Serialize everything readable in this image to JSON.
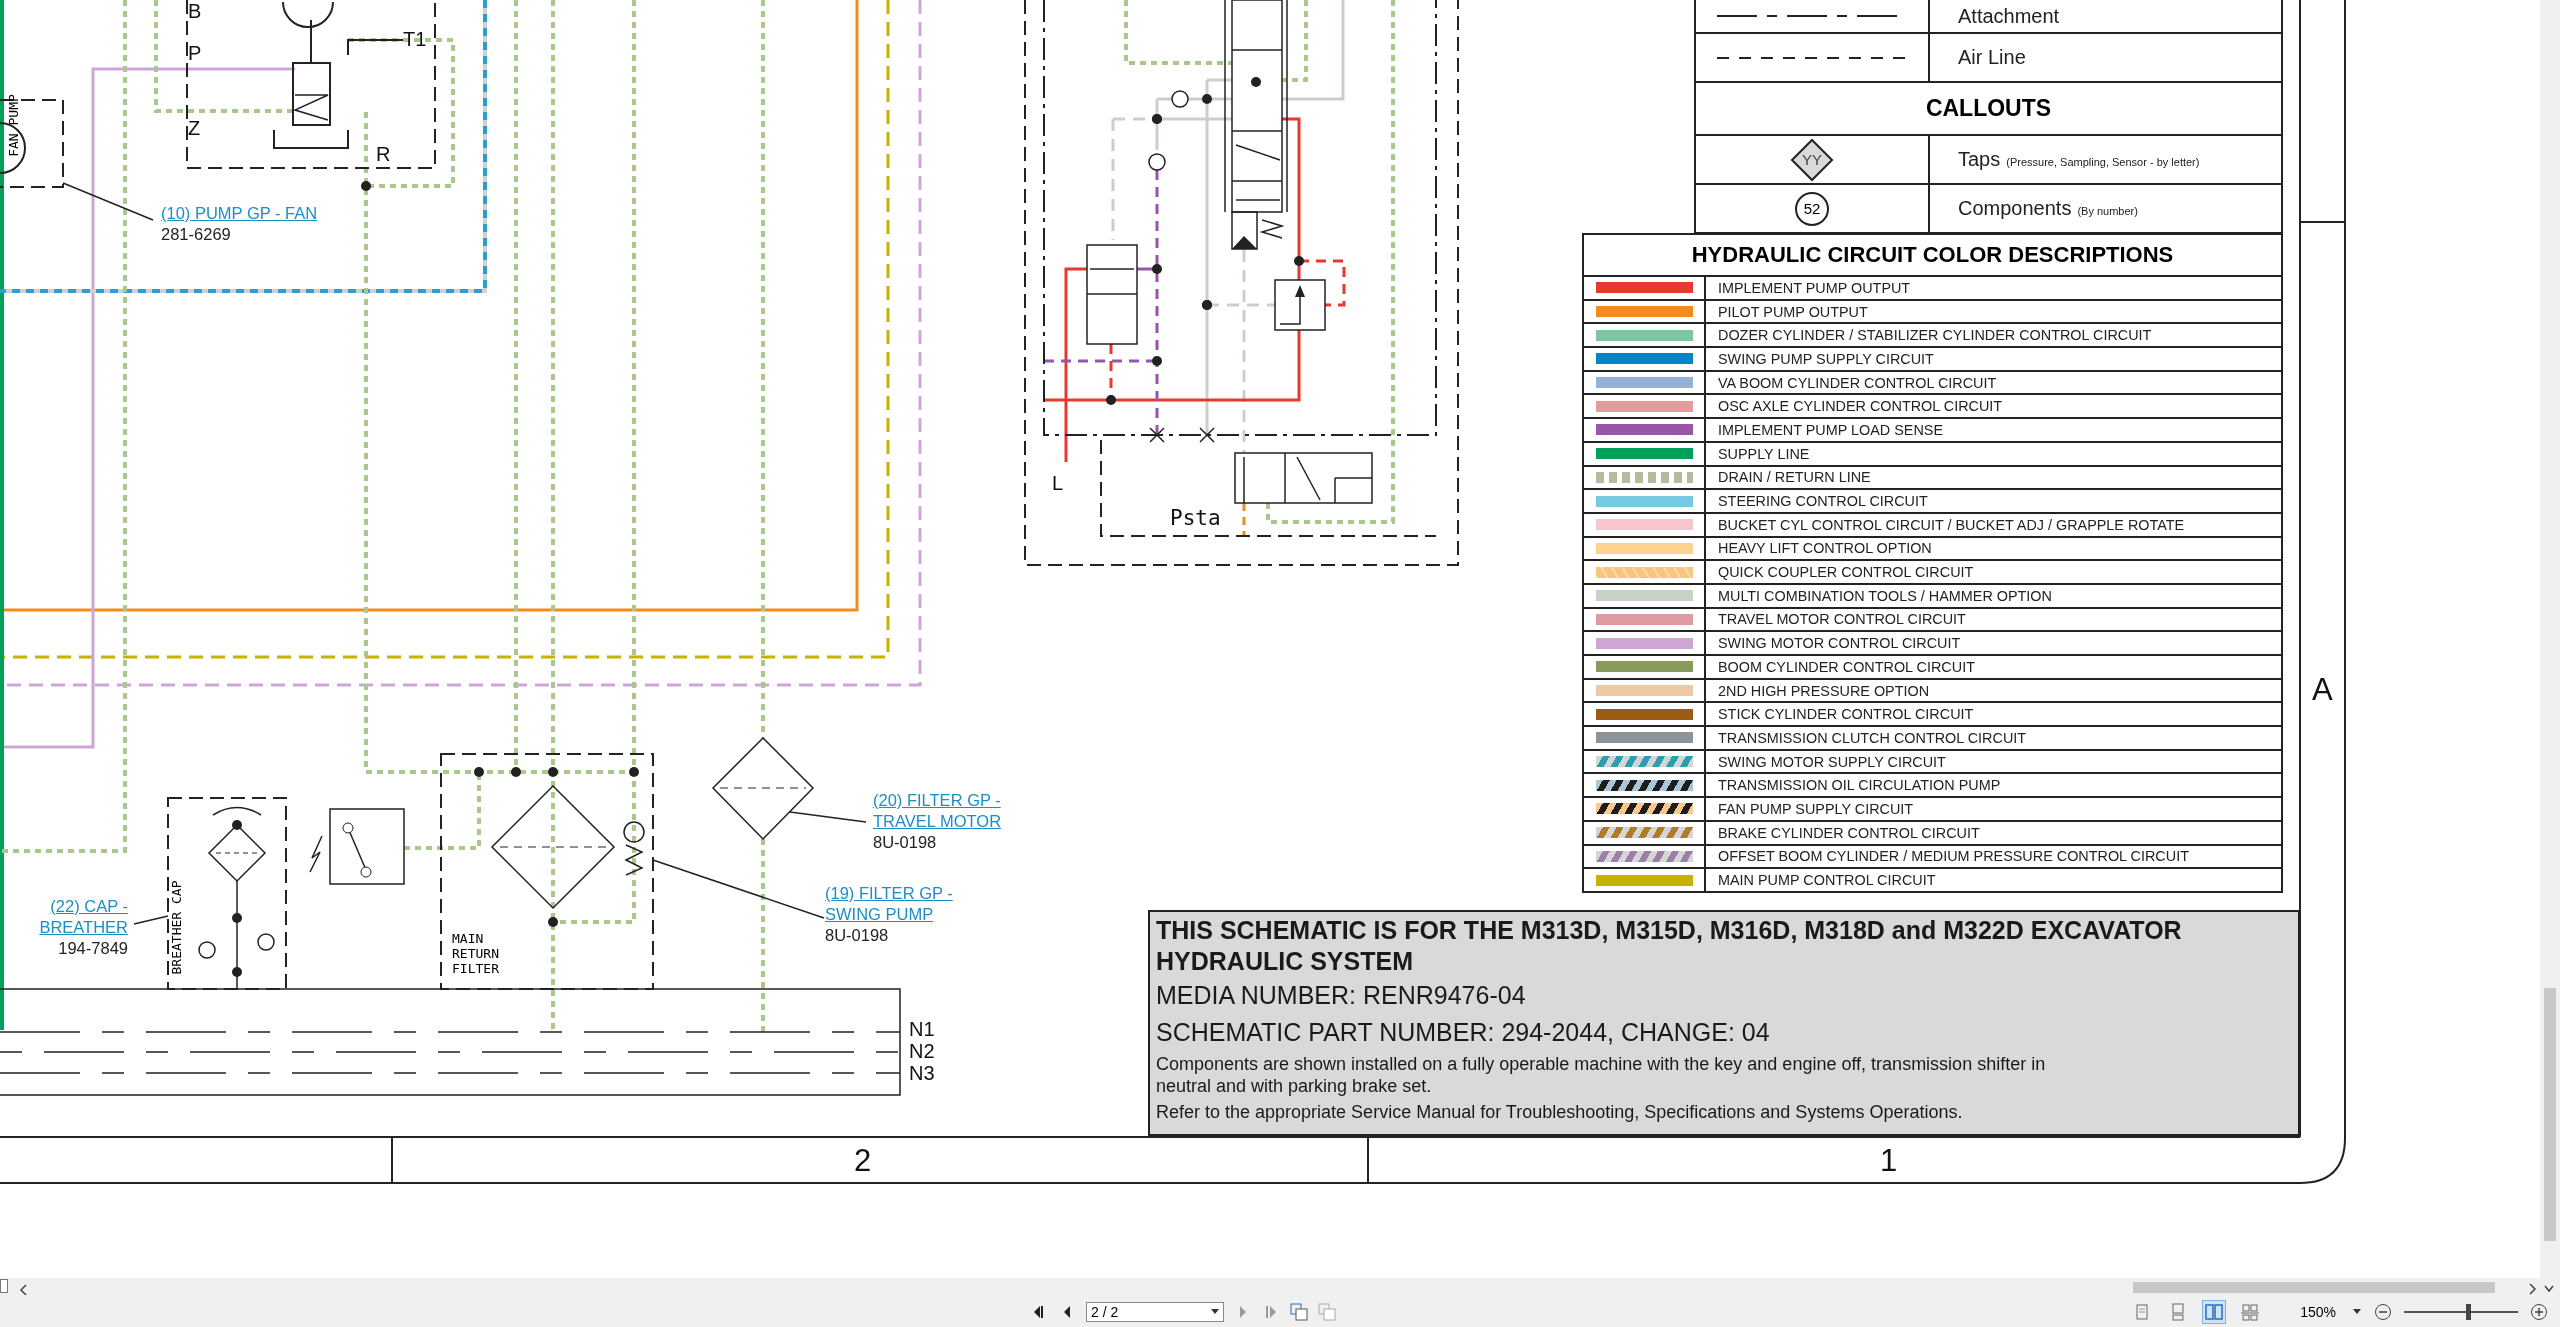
{
  "line_legend": [
    {
      "kind": "long-dash",
      "label": "Attachment"
    },
    {
      "kind": "short-dash",
      "label": "Air Line"
    }
  ],
  "callouts": {
    "title": "CALLOUTS",
    "items": [
      {
        "kind": "tap",
        "symbol": "YY",
        "label": "Taps",
        "note": "(Pressure, Sampling, Sensor - by letter)"
      },
      {
        "kind": "component",
        "symbol": "52",
        "label": "Components",
        "note": "(By number)"
      }
    ]
  },
  "color_legend": {
    "title": "HYDRAULIC CIRCUIT COLOR DESCRIPTIONS",
    "items": [
      {
        "kind": "solid",
        "color": "#e8392f",
        "label": "IMPLEMENT PUMP OUTPUT"
      },
      {
        "kind": "solid",
        "color": "#f28c1f",
        "label": "PILOT PUMP OUTPUT"
      },
      {
        "kind": "solid",
        "color": "#7cc7a0",
        "label": "DOZER CYLINDER / STABILIZER CYLINDER CONTROL CIRCUIT"
      },
      {
        "kind": "solid",
        "color": "#0a83c4",
        "label": "SWING PUMP SUPPLY CIRCUIT"
      },
      {
        "kind": "solid",
        "color": "#94b1d6",
        "label": "VA BOOM CYLINDER CONTROL CIRCUIT"
      },
      {
        "kind": "solid",
        "color": "#e29c9c",
        "label": "OSC AXLE CYLINDER CONTROL CIRCUIT"
      },
      {
        "kind": "solid",
        "color": "#9955a8",
        "label": "IMPLEMENT PUMP LOAD SENSE"
      },
      {
        "kind": "solid",
        "color": "#00a05a",
        "label": "SUPPLY LINE"
      },
      {
        "kind": "dotted",
        "color": "#bbb8a0",
        "label": "DRAIN / RETURN LINE"
      },
      {
        "kind": "solid",
        "color": "#76c8e4",
        "label": "STEERING CONTROL CIRCUIT"
      },
      {
        "kind": "solid",
        "color": "#f6c6d0",
        "label": "BUCKET CYL CONTROL CIRCUIT / BUCKET ADJ / GRAPPLE ROTATE"
      },
      {
        "kind": "solid",
        "color": "#fdd390",
        "label": "HEAVY LIFT CONTROL OPTION"
      },
      {
        "kind": "mottled",
        "color": "#f9c57e",
        "label": "QUICK COUPLER CONTROL CIRCUIT"
      },
      {
        "kind": "solid",
        "color": "#c9d0c8",
        "label": "MULTI COMBINATION TOOLS / HAMMER OPTION"
      },
      {
        "kind": "solid",
        "color": "#dd9aa0",
        "label": "TRAVEL MOTOR CONTROL CIRCUIT"
      },
      {
        "kind": "solid",
        "color": "#cda6d6",
        "label": "SWING MOTOR CONTROL CIRCUIT"
      },
      {
        "kind": "solid",
        "color": "#8a9a5b",
        "label": "BOOM CYLINDER CONTROL CIRCUIT"
      },
      {
        "kind": "solid",
        "color": "#eec7a4",
        "label": "2ND HIGH PRESSURE OPTION"
      },
      {
        "kind": "solid",
        "color": "#9a5b14",
        "label": "STICK CYLINDER CONTROL CIRCUIT"
      },
      {
        "kind": "solid",
        "color": "#8c9499",
        "label": "TRANSMISSION CLUTCH CONTROL CIRCUIT"
      },
      {
        "kind": "striped",
        "color": "#2a9fb0",
        "stripe": {
          "color": "#d2d6d6"
        },
        "label": "SWING MOTOR SUPPLY CIRCUIT"
      },
      {
        "kind": "striped",
        "color": "#1d1d1d",
        "stripe": {
          "color": "#a9c7d8"
        },
        "label": "TRANSMISSION OIL CIRCULATION PUMP"
      },
      {
        "kind": "striped",
        "color": "#1d1d1d",
        "stripe": {
          "color": "#f9c88a"
        },
        "label": "FAN PUMP SUPPLY CIRCUIT"
      },
      {
        "kind": "striped",
        "color": "#b07a2a",
        "stripe": {
          "color": "#d2d6d6"
        },
        "label": "BRAKE CYLINDER CONTROL CIRCUIT"
      },
      {
        "kind": "striped",
        "color": "#9a80a8",
        "stripe": {
          "color": "#d6d6d6"
        },
        "label": "OFFSET BOOM CYLINDER / MEDIUM PRESSURE CONTROL CIRCUIT"
      },
      {
        "kind": "solid",
        "color": "#c5b300",
        "label": "MAIN PUMP CONTROL CIRCUIT"
      }
    ]
  },
  "schematic": {
    "port_labels": [
      "B",
      "P",
      "T1",
      "Z",
      "R",
      "L",
      "Psta"
    ],
    "tank_levels": [
      "N1",
      "N2",
      "N3"
    ],
    "component_labels": [
      "FAN PUMP",
      "BREATHER CAP",
      "MAIN RETURN FILTER"
    ],
    "callouts": [
      {
        "title_lines": [
          "(10) PUMP GP - FAN"
        ],
        "part": "281-6269"
      },
      {
        "title_lines": [
          "(22) CAP -",
          "BREATHER"
        ],
        "part": "194-7849"
      },
      {
        "title_lines": [
          "(20) FILTER GP -",
          "TRAVEL MOTOR"
        ],
        "part": "8U-0198"
      },
      {
        "title_lines": [
          "(19) FILTER GP -",
          "SWING PUMP"
        ],
        "part": "8U-0198"
      }
    ]
  },
  "zones": {
    "columns": [
      "2",
      "1"
    ],
    "rows": [
      "A"
    ]
  },
  "title_block": {
    "heading": "THIS SCHEMATIC IS FOR THE M313D, M315D, M316D, M318D and M322D EXCAVATOR HYDRAULIC SYSTEM",
    "media": "MEDIA NUMBER: RENR9476-04",
    "part_number": "SCHEMATIC PART NUMBER: 294-2044, CHANGE: 04",
    "notes": [
      "Components are shown installed on a fully operable machine with the key and engine off, transmission shifter in neutral and with parking brake set.",
      "Refer to the appropriate Service Manual for Troubleshooting, Specifications and Systems Operations."
    ]
  },
  "viewer": {
    "page_field": "2 / 2",
    "zoom": "150%",
    "zoom_slider": {
      "level": 0.56
    },
    "view_modes": [
      {
        "kind": "single",
        "selected": false
      },
      {
        "kind": "continuous",
        "selected": false
      },
      {
        "kind": "two-page",
        "selected": true
      },
      {
        "kind": "split",
        "selected": false
      }
    ]
  }
}
